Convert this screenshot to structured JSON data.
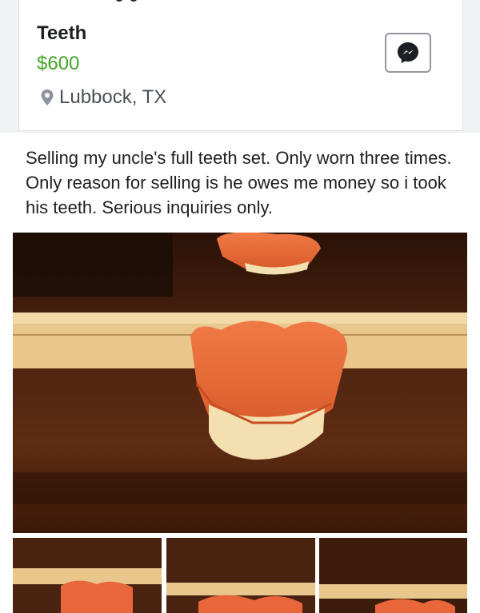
{
  "listing": {
    "title": "Teeth",
    "price": "$600",
    "location": "Lubbock, TX",
    "description": "Selling my uncle's full teeth set. Only worn three times. Only reason for selling is he owes me money so i took his teeth. Serious inquiries only."
  },
  "icons": {
    "location": "map-pin-icon",
    "message": "messenger-icon"
  },
  "colors": {
    "price": "#42a627",
    "text": "#1c1e21",
    "muted": "#4b4f56",
    "wood": "#5a2a10",
    "denture_gum": "#e8663a",
    "teeth": "#f3dfb0",
    "ruler": "#e9c68c"
  },
  "photos": {
    "thumbnail_count": 3
  }
}
